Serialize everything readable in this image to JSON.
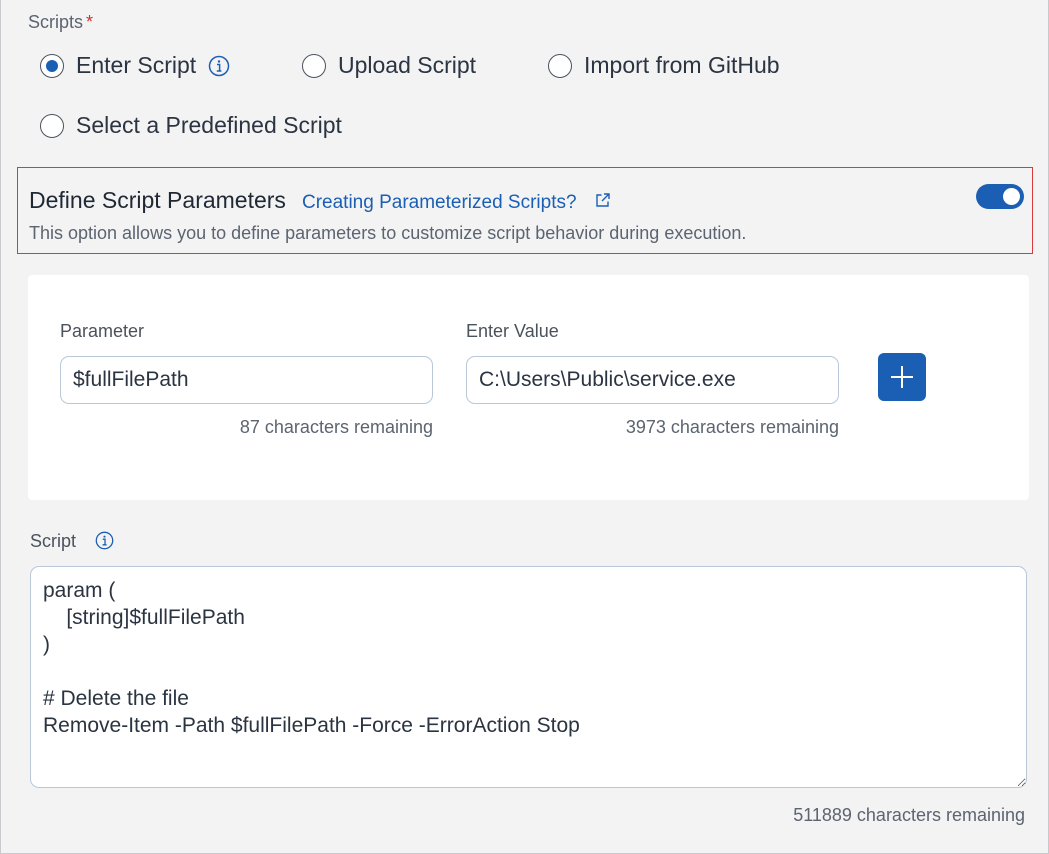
{
  "scripts": {
    "label": "Scripts",
    "required_mark": "*",
    "options": [
      {
        "label": "Enter Script",
        "selected": true
      },
      {
        "label": "Upload Script",
        "selected": false
      },
      {
        "label": "Import from GitHub",
        "selected": false
      },
      {
        "label": "Select a Predefined Script",
        "selected": false
      }
    ]
  },
  "parameters_section": {
    "title": "Define Script Parameters",
    "link_text": "Creating Parameterized Scripts?",
    "description": "This option allows you to define parameters to customize script behavior during execution.",
    "toggle_on": true,
    "accent_color": "#1a5fb4",
    "highlight_border_color": "#d93a3a"
  },
  "parameter_row": {
    "parameter_label": "Parameter",
    "parameter_value": "$fullFilePath",
    "parameter_remaining": "87 characters remaining",
    "value_label": "Enter Value",
    "value_value": "C:\\Users\\Public\\service.exe",
    "value_remaining": "3973 characters remaining",
    "add_icon": "plus-icon"
  },
  "script": {
    "label": "Script",
    "content": "param (\n    [string]$fullFilePath\n)\n\n# Delete the file\nRemove-Item -Path $fullFilePath -Force -ErrorAction Stop",
    "remaining": "511889 characters remaining"
  }
}
